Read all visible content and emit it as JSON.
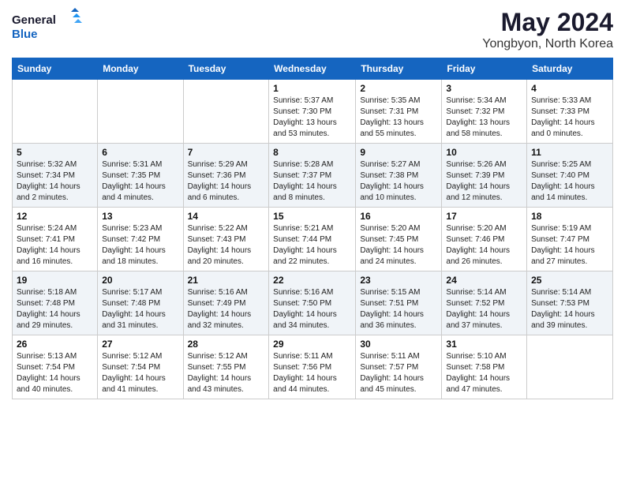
{
  "logo": {
    "line1": "General",
    "line2": "Blue"
  },
  "title": "May 2024",
  "subtitle": "Yongbyon, North Korea",
  "days_header": [
    "Sunday",
    "Monday",
    "Tuesday",
    "Wednesday",
    "Thursday",
    "Friday",
    "Saturday"
  ],
  "weeks": [
    [
      {
        "num": "",
        "sunrise": "",
        "sunset": "",
        "daylight": ""
      },
      {
        "num": "",
        "sunrise": "",
        "sunset": "",
        "daylight": ""
      },
      {
        "num": "",
        "sunrise": "",
        "sunset": "",
        "daylight": ""
      },
      {
        "num": "1",
        "sunrise": "Sunrise: 5:37 AM",
        "sunset": "Sunset: 7:30 PM",
        "daylight": "Daylight: 13 hours and 53 minutes."
      },
      {
        "num": "2",
        "sunrise": "Sunrise: 5:35 AM",
        "sunset": "Sunset: 7:31 PM",
        "daylight": "Daylight: 13 hours and 55 minutes."
      },
      {
        "num": "3",
        "sunrise": "Sunrise: 5:34 AM",
        "sunset": "Sunset: 7:32 PM",
        "daylight": "Daylight: 13 hours and 58 minutes."
      },
      {
        "num": "4",
        "sunrise": "Sunrise: 5:33 AM",
        "sunset": "Sunset: 7:33 PM",
        "daylight": "Daylight: 14 hours and 0 minutes."
      }
    ],
    [
      {
        "num": "5",
        "sunrise": "Sunrise: 5:32 AM",
        "sunset": "Sunset: 7:34 PM",
        "daylight": "Daylight: 14 hours and 2 minutes."
      },
      {
        "num": "6",
        "sunrise": "Sunrise: 5:31 AM",
        "sunset": "Sunset: 7:35 PM",
        "daylight": "Daylight: 14 hours and 4 minutes."
      },
      {
        "num": "7",
        "sunrise": "Sunrise: 5:29 AM",
        "sunset": "Sunset: 7:36 PM",
        "daylight": "Daylight: 14 hours and 6 minutes."
      },
      {
        "num": "8",
        "sunrise": "Sunrise: 5:28 AM",
        "sunset": "Sunset: 7:37 PM",
        "daylight": "Daylight: 14 hours and 8 minutes."
      },
      {
        "num": "9",
        "sunrise": "Sunrise: 5:27 AM",
        "sunset": "Sunset: 7:38 PM",
        "daylight": "Daylight: 14 hours and 10 minutes."
      },
      {
        "num": "10",
        "sunrise": "Sunrise: 5:26 AM",
        "sunset": "Sunset: 7:39 PM",
        "daylight": "Daylight: 14 hours and 12 minutes."
      },
      {
        "num": "11",
        "sunrise": "Sunrise: 5:25 AM",
        "sunset": "Sunset: 7:40 PM",
        "daylight": "Daylight: 14 hours and 14 minutes."
      }
    ],
    [
      {
        "num": "12",
        "sunrise": "Sunrise: 5:24 AM",
        "sunset": "Sunset: 7:41 PM",
        "daylight": "Daylight: 14 hours and 16 minutes."
      },
      {
        "num": "13",
        "sunrise": "Sunrise: 5:23 AM",
        "sunset": "Sunset: 7:42 PM",
        "daylight": "Daylight: 14 hours and 18 minutes."
      },
      {
        "num": "14",
        "sunrise": "Sunrise: 5:22 AM",
        "sunset": "Sunset: 7:43 PM",
        "daylight": "Daylight: 14 hours and 20 minutes."
      },
      {
        "num": "15",
        "sunrise": "Sunrise: 5:21 AM",
        "sunset": "Sunset: 7:44 PM",
        "daylight": "Daylight: 14 hours and 22 minutes."
      },
      {
        "num": "16",
        "sunrise": "Sunrise: 5:20 AM",
        "sunset": "Sunset: 7:45 PM",
        "daylight": "Daylight: 14 hours and 24 minutes."
      },
      {
        "num": "17",
        "sunrise": "Sunrise: 5:20 AM",
        "sunset": "Sunset: 7:46 PM",
        "daylight": "Daylight: 14 hours and 26 minutes."
      },
      {
        "num": "18",
        "sunrise": "Sunrise: 5:19 AM",
        "sunset": "Sunset: 7:47 PM",
        "daylight": "Daylight: 14 hours and 27 minutes."
      }
    ],
    [
      {
        "num": "19",
        "sunrise": "Sunrise: 5:18 AM",
        "sunset": "Sunset: 7:48 PM",
        "daylight": "Daylight: 14 hours and 29 minutes."
      },
      {
        "num": "20",
        "sunrise": "Sunrise: 5:17 AM",
        "sunset": "Sunset: 7:48 PM",
        "daylight": "Daylight: 14 hours and 31 minutes."
      },
      {
        "num": "21",
        "sunrise": "Sunrise: 5:16 AM",
        "sunset": "Sunset: 7:49 PM",
        "daylight": "Daylight: 14 hours and 32 minutes."
      },
      {
        "num": "22",
        "sunrise": "Sunrise: 5:16 AM",
        "sunset": "Sunset: 7:50 PM",
        "daylight": "Daylight: 14 hours and 34 minutes."
      },
      {
        "num": "23",
        "sunrise": "Sunrise: 5:15 AM",
        "sunset": "Sunset: 7:51 PM",
        "daylight": "Daylight: 14 hours and 36 minutes."
      },
      {
        "num": "24",
        "sunrise": "Sunrise: 5:14 AM",
        "sunset": "Sunset: 7:52 PM",
        "daylight": "Daylight: 14 hours and 37 minutes."
      },
      {
        "num": "25",
        "sunrise": "Sunrise: 5:14 AM",
        "sunset": "Sunset: 7:53 PM",
        "daylight": "Daylight: 14 hours and 39 minutes."
      }
    ],
    [
      {
        "num": "26",
        "sunrise": "Sunrise: 5:13 AM",
        "sunset": "Sunset: 7:54 PM",
        "daylight": "Daylight: 14 hours and 40 minutes."
      },
      {
        "num": "27",
        "sunrise": "Sunrise: 5:12 AM",
        "sunset": "Sunset: 7:54 PM",
        "daylight": "Daylight: 14 hours and 41 minutes."
      },
      {
        "num": "28",
        "sunrise": "Sunrise: 5:12 AM",
        "sunset": "Sunset: 7:55 PM",
        "daylight": "Daylight: 14 hours and 43 minutes."
      },
      {
        "num": "29",
        "sunrise": "Sunrise: 5:11 AM",
        "sunset": "Sunset: 7:56 PM",
        "daylight": "Daylight: 14 hours and 44 minutes."
      },
      {
        "num": "30",
        "sunrise": "Sunrise: 5:11 AM",
        "sunset": "Sunset: 7:57 PM",
        "daylight": "Daylight: 14 hours and 45 minutes."
      },
      {
        "num": "31",
        "sunrise": "Sunrise: 5:10 AM",
        "sunset": "Sunset: 7:58 PM",
        "daylight": "Daylight: 14 hours and 47 minutes."
      },
      {
        "num": "",
        "sunrise": "",
        "sunset": "",
        "daylight": ""
      }
    ]
  ]
}
